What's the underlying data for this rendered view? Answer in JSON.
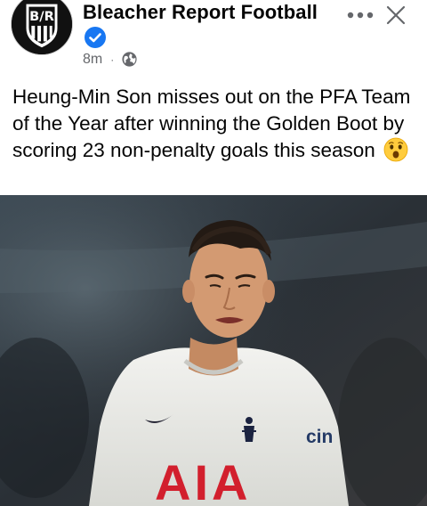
{
  "post": {
    "page_name": "Bleacher Report Football",
    "avatar_text": "B/R",
    "time": "8m",
    "separator": "·",
    "audience_icon": "globe-icon",
    "verified_icon": "verified-badge-icon",
    "text": "Heung-Min Son misses out on the PFA Team of the Year after winning the Golden Boot by scoring 23 non-penalty goals this season",
    "emoji_icon": "astonished-face-emoji"
  },
  "actions": {
    "more_icon": "more-options-icon",
    "close_icon": "close-icon"
  },
  "photo": {
    "shirt_sponsor": "AIA",
    "sleeve_sponsor": "cin"
  },
  "colors": {
    "verified": "#1877f2",
    "meta_text": "#65676b",
    "sponsor_red": "#d21f2d",
    "avatar_bg": "#111111"
  }
}
